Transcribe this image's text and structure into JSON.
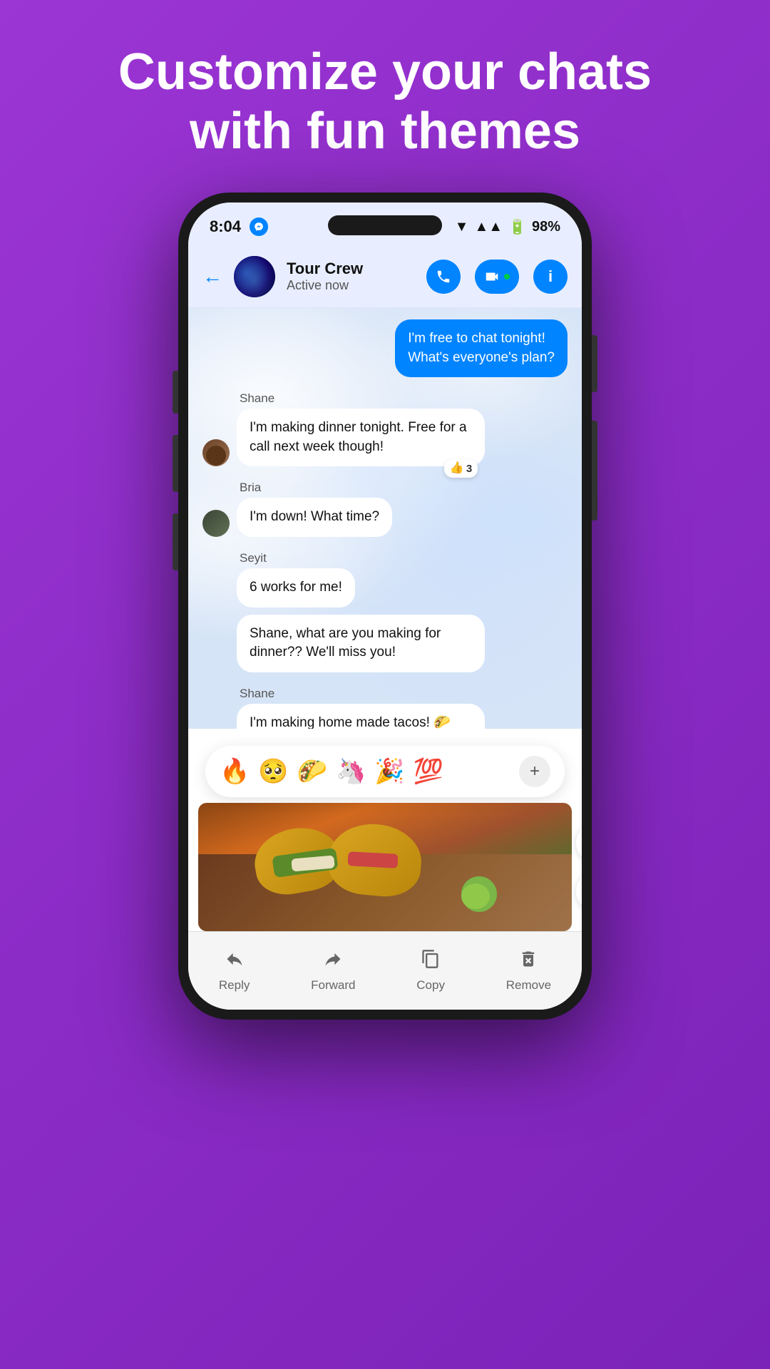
{
  "headline": {
    "line1": "Customize your chats",
    "line2": "with fun themes"
  },
  "status_bar": {
    "time": "8:04",
    "battery": "98%"
  },
  "header": {
    "group_name": "Tour Crew",
    "active_status": "Active now",
    "back_label": "←",
    "call_icon": "📞",
    "info_icon": "ℹ"
  },
  "messages": [
    {
      "id": "msg1",
      "own": true,
      "text": "I'm free to chat tonight! What's everyone's plan?"
    },
    {
      "id": "msg2",
      "sender": "Shane",
      "text": "I'm making dinner tonight. Free for a call next week though!",
      "reaction": "👍",
      "reaction_count": "3"
    },
    {
      "id": "msg3",
      "sender": "Bria",
      "text": "I'm down! What time?"
    },
    {
      "id": "msg4",
      "sender": "Seyit",
      "text": "6 works for me!"
    },
    {
      "id": "msg5",
      "sender": "Seyit",
      "text": "Shane, what are you making for dinner?? We'll miss you!"
    },
    {
      "id": "msg6",
      "sender": "Shane",
      "text": "I'm making home made tacos! 🌮Will report back😊"
    }
  ],
  "reaction_bar": {
    "emojis": [
      "🔥",
      "🥺",
      "🌮",
      "🦄",
      "🎉",
      "💯"
    ],
    "plus_label": "+"
  },
  "side_actions": {
    "share_icon": "share",
    "edit_icon": "edit"
  },
  "bottom_bar": {
    "actions": [
      {
        "label": "Reply",
        "icon": "reply"
      },
      {
        "label": "Forward",
        "icon": "forward"
      },
      {
        "label": "Copy",
        "icon": "copy"
      },
      {
        "label": "Remove",
        "icon": "remove"
      }
    ]
  }
}
